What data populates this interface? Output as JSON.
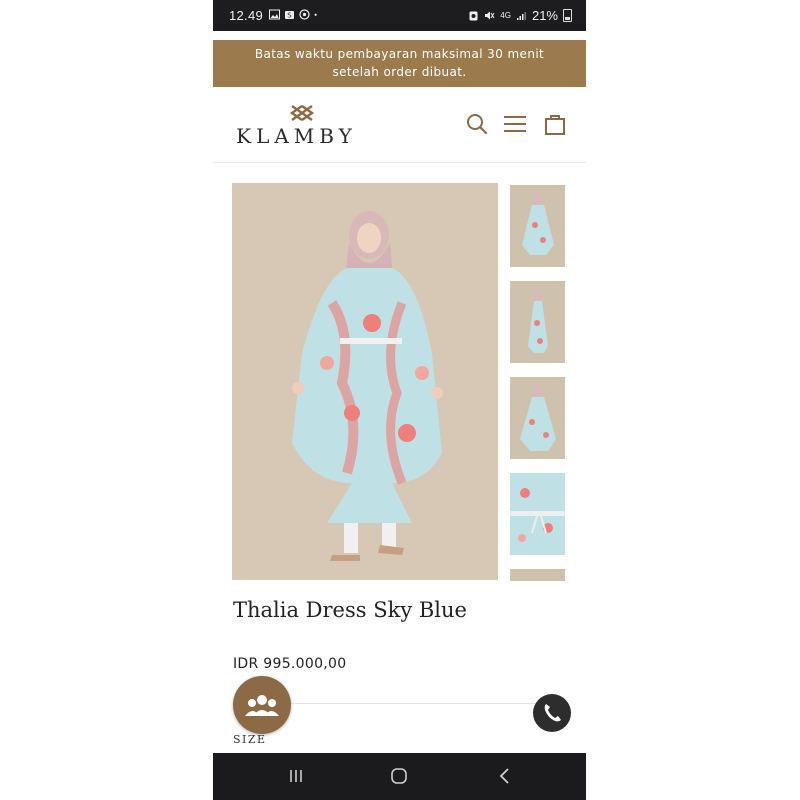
{
  "status_bar": {
    "time": "12.49",
    "battery": "21%",
    "network": "4G"
  },
  "announcement": {
    "line1": "Batas waktu pembayaran maksimal 30 menit",
    "line2": "setelah order dibuat."
  },
  "header": {
    "brand": "KLAMBY",
    "icons": [
      "search-icon",
      "menu-icon",
      "cart-icon"
    ]
  },
  "product": {
    "title": "Thalia Dress Sky Blue",
    "price": "IDR 995.000,00",
    "size_label": "SIZE"
  },
  "gallery": {
    "thumbnail_count": 5
  },
  "floating": {
    "community_icon": "community-icon",
    "whatsapp_icon": "phone-icon"
  },
  "colors": {
    "announcement_bg": "#9b7a4e",
    "community_bg": "#8c6a45",
    "photo_bg": "#d6c8b5"
  }
}
